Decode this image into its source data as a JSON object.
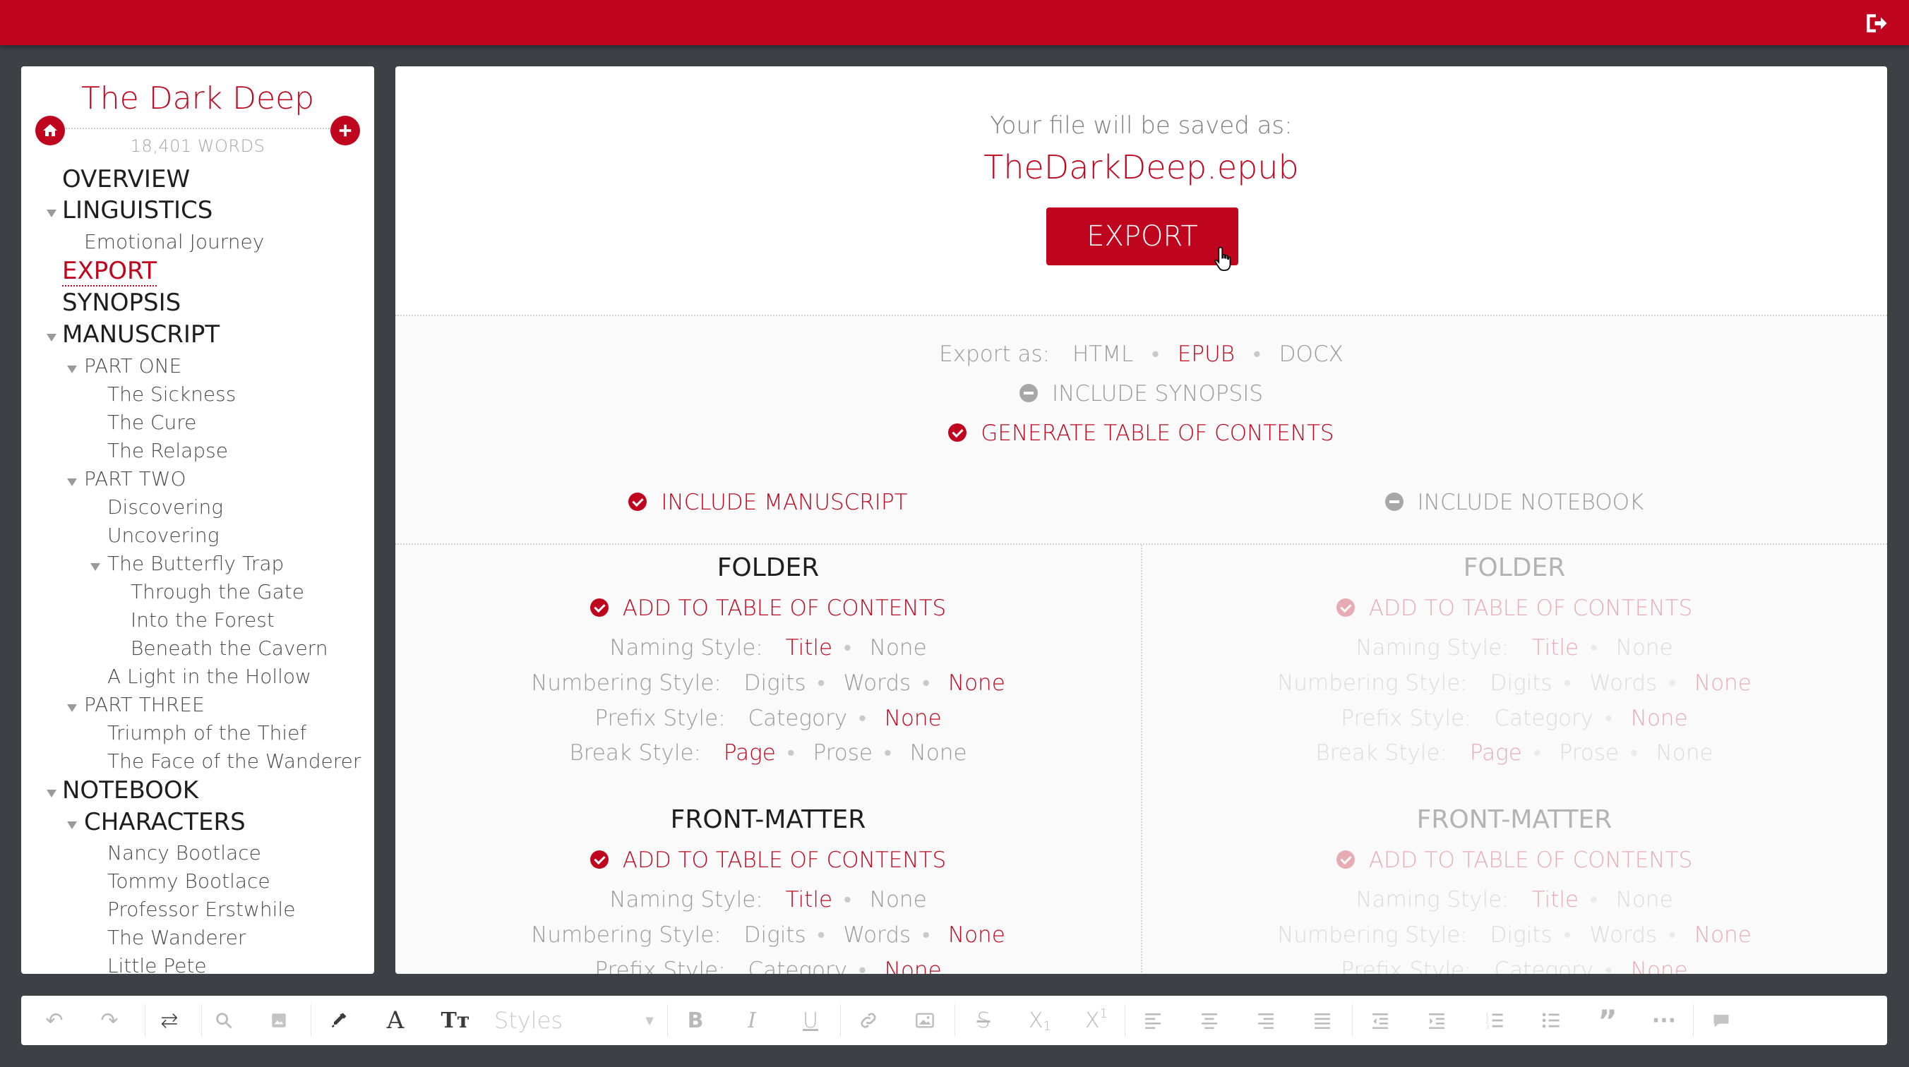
{
  "colors": {
    "accent": "#c0061e",
    "background": "#3d4045",
    "panel": "#ffffff"
  },
  "header": {
    "logout_icon": "logout-icon"
  },
  "sidebar": {
    "project_title": "The Dark Deep",
    "word_count": "18,401 WORDS",
    "home_icon": "home-icon",
    "add_icon": "plus-icon",
    "tree": [
      {
        "label": "OVERVIEW"
      },
      {
        "label": "LINGUISTICS",
        "expanded": true
      },
      {
        "label": "Emotional Journey"
      },
      {
        "label": "EXPORT",
        "active": true
      },
      {
        "label": "SYNOPSIS"
      },
      {
        "label": "MANUSCRIPT",
        "expanded": true
      },
      {
        "label": "PART ONE",
        "expanded": true
      },
      {
        "label": "The Sickness"
      },
      {
        "label": "The Cure"
      },
      {
        "label": "The Relapse"
      },
      {
        "label": "PART TWO",
        "expanded": true
      },
      {
        "label": "Discovering"
      },
      {
        "label": "Uncovering"
      },
      {
        "label": "The Butterfly Trap",
        "expanded": true
      },
      {
        "label": "Through the Gate"
      },
      {
        "label": "Into the Forest"
      },
      {
        "label": "Beneath the Cavern"
      },
      {
        "label": "A Light in the Hollow"
      },
      {
        "label": "PART THREE",
        "expanded": true
      },
      {
        "label": "Triumph of the Thief"
      },
      {
        "label": "The Face of the Wanderer"
      },
      {
        "label": "NOTEBOOK",
        "expanded": true
      },
      {
        "label": "CHARACTERS",
        "expanded": true
      },
      {
        "label": "Nancy Bootlace"
      },
      {
        "label": "Tommy Bootlace"
      },
      {
        "label": "Professor Erstwhile"
      },
      {
        "label": "The Wanderer"
      },
      {
        "label": "Little Pete"
      }
    ]
  },
  "main": {
    "saved_label": "Your file will be saved as:",
    "filename": "TheDarkDeep.epub",
    "export_button": "EXPORT",
    "export_as_label": "Export as:",
    "formats": [
      "HTML",
      "EPUB",
      "DOCX"
    ],
    "selected_format": "EPUB",
    "include_synopsis": {
      "label": "INCLUDE SYNOPSIS",
      "checked": false
    },
    "generate_toc": {
      "label": "GENERATE TABLE OF CONTENTS",
      "checked": true
    },
    "columns": [
      {
        "toggle_label": "INCLUDE MANUSCRIPT",
        "checked": true,
        "sections": [
          {
            "heading": "FOLDER",
            "add_toc": "ADD TO TABLE OF CONTENTS",
            "naming_label": "Naming Style:",
            "naming": [
              "Title",
              "None"
            ],
            "numbering_label": "Numbering Style:",
            "numbering": [
              "Digits",
              "Words",
              "None"
            ],
            "prefix_label": "Prefix Style:",
            "prefix": [
              "Category",
              "None"
            ],
            "break_label": "Break Style:",
            "break": [
              "Page",
              "Prose",
              "None"
            ]
          },
          {
            "heading": "FRONT-MATTER",
            "add_toc": "ADD TO TABLE OF CONTENTS",
            "naming_label": "Naming Style:",
            "naming": [
              "Title",
              "None"
            ],
            "numbering_label": "Numbering Style:",
            "numbering": [
              "Digits",
              "Words",
              "None"
            ],
            "prefix_label": "Prefix Style:",
            "prefix": [
              "Category",
              "None"
            ]
          }
        ]
      },
      {
        "toggle_label": "INCLUDE NOTEBOOK",
        "checked": false,
        "sections": [
          {
            "heading": "FOLDER",
            "add_toc": "ADD TO TABLE OF CONTENTS",
            "naming_label": "Naming Style:",
            "naming": [
              "Title",
              "None"
            ],
            "numbering_label": "Numbering Style:",
            "numbering": [
              "Digits",
              "Words",
              "None"
            ],
            "prefix_label": "Prefix Style:",
            "prefix": [
              "Category",
              "None"
            ],
            "break_label": "Break Style:",
            "break": [
              "Page",
              "Prose",
              "None"
            ]
          },
          {
            "heading": "FRONT-MATTER",
            "add_toc": "ADD TO TABLE OF CONTENTS",
            "naming_label": "Naming Style:",
            "naming": [
              "Title",
              "None"
            ],
            "numbering_label": "Numbering Style:",
            "numbering": [
              "Digits",
              "Words",
              "None"
            ],
            "prefix_label": "Prefix Style:",
            "prefix": [
              "Category",
              "None"
            ]
          }
        ]
      }
    ]
  },
  "toolbar": {
    "styles_placeholder": "Styles",
    "icons": [
      "undo-icon",
      "redo-icon",
      "sync-icon",
      "search-icon",
      "image-icon",
      "eyedropper-icon",
      "font-color-icon",
      "text-size-icon",
      "bold-icon",
      "italic-icon",
      "underline-icon",
      "link-icon",
      "insert-image-icon",
      "strikethrough-icon",
      "subscript-icon",
      "superscript-icon",
      "align-left-icon",
      "align-center-icon",
      "align-right-icon",
      "align-justify-icon",
      "outdent-icon",
      "indent-icon",
      "ordered-list-icon",
      "bullet-list-icon",
      "quote-icon",
      "more-icon",
      "comment-icon"
    ]
  }
}
